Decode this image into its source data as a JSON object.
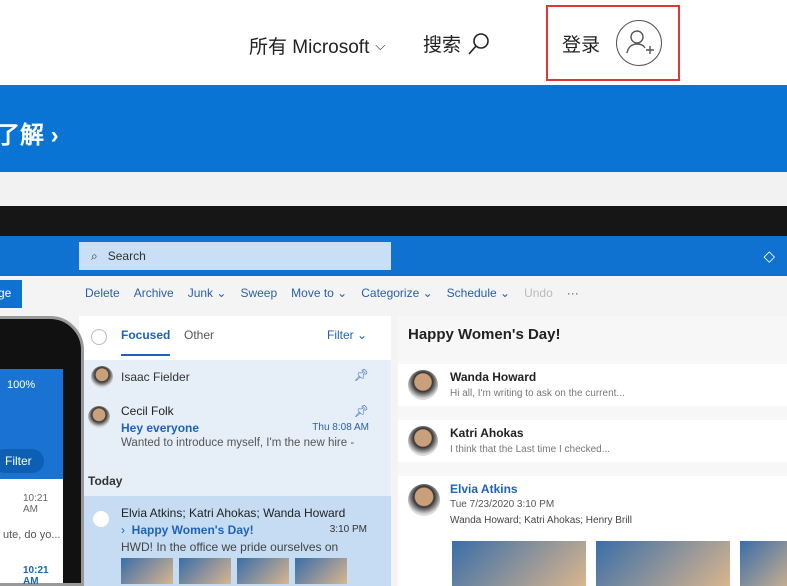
{
  "header": {
    "all_microsoft": "所有 Microsoft",
    "search": "搜索",
    "login": "登录"
  },
  "banner": {
    "link": "了解 ›"
  },
  "app": {
    "search_placeholder": "Search",
    "new_button": "ge",
    "toolbar": [
      "Delete",
      "Archive",
      "Junk ⌄",
      "Sweep",
      "Move to ⌄",
      "Categorize ⌄",
      "Schedule ⌄",
      "Undo",
      "···"
    ],
    "tabs": {
      "focused": "Focused",
      "other": "Other",
      "filter": "Filter ⌄"
    },
    "pinned": [
      {
        "name": "Isaac Fielder"
      },
      {
        "name": "Cecil Folk",
        "subject": "Hey everyone",
        "time": "Thu 8:08 AM",
        "preview": "Wanted to introduce myself, I'm the new hire -"
      }
    ],
    "section": "Today",
    "selected": {
      "names": "Elvia Atkins; Katri Ahokas; Wanda Howard",
      "subject": "Happy Women's Day!",
      "time": "3:10 PM",
      "preview": "HWD! In the office we pride ourselves on"
    },
    "phone": {
      "status": "100%",
      "filter": "Filter",
      "time1": "10:21 AM",
      "snippet": "ute, do yo...",
      "time2": "10:21 AM"
    },
    "reading": {
      "title": "Happy Women's Day!",
      "messages": [
        {
          "name": "Wanda Howard",
          "preview": "Hi all, I'm writing to ask on the current..."
        },
        {
          "name": "Katri Ahokas",
          "preview": "I think that the Last time I checked..."
        }
      ],
      "open": {
        "name": "Elvia Atkins",
        "date": "Tue 7/23/2020 3:10 PM",
        "to": "Wanda Howard; Katri Ahokas; Henry Brill"
      }
    }
  }
}
